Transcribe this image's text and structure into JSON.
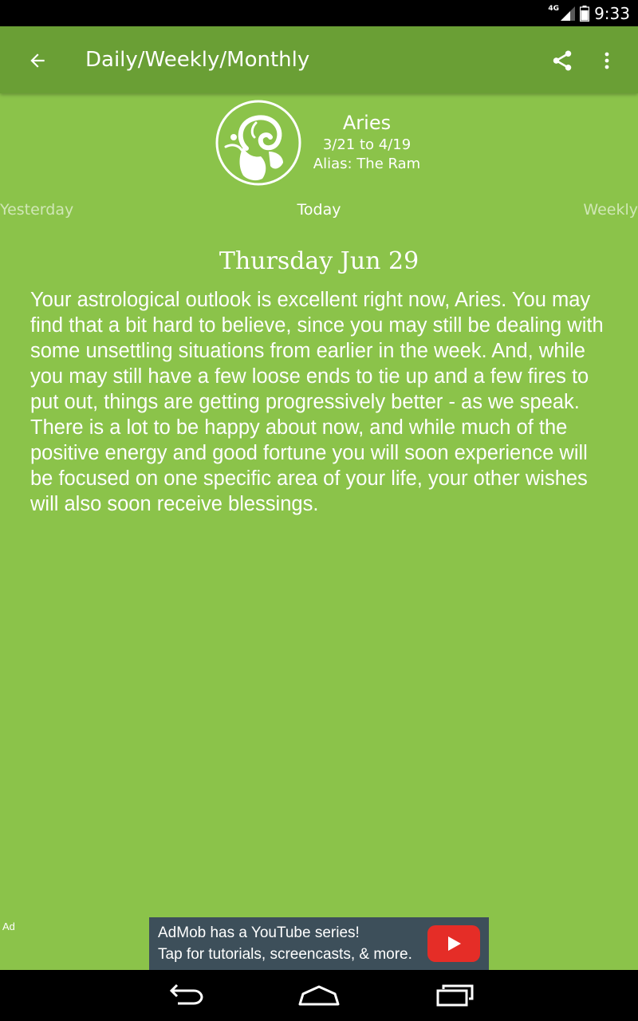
{
  "status_bar": {
    "network": "4G",
    "time": "9:33"
  },
  "toolbar": {
    "title": "Daily/Weekly/Monthly"
  },
  "sign": {
    "name": "Aries",
    "dates": "3/21 to 4/19",
    "alias": "Alias: The Ram"
  },
  "tabs": {
    "previous": "Yesterday",
    "current": "Today",
    "next": "Weekly"
  },
  "reading": {
    "date": "Thursday Jun 29",
    "text": "Your astrological outlook is excellent right now, Aries. You may find that a bit hard to believe, since you may still be dealing with some unsettling situations from earlier in the week. And, while you may still have a few loose ends to tie up and a few fires to put out, things are getting progressively better - as we speak. There is a lot to be happy about now, and while much of the positive energy and good fortune you will soon experience will be focused on one specific area of your life, your other wishes will also soon receive blessings."
  },
  "ad": {
    "label": "Ad",
    "line1": "AdMob has a YouTube series!",
    "line2": "Tap for tutorials, screencasts, & more."
  },
  "icons": {
    "back": "arrow-left",
    "share": "share",
    "more": "vertical-dots",
    "sign_logo": "ram",
    "ad_play": "youtube-play",
    "nav_back": "back",
    "nav_home": "home",
    "nav_recents": "recents"
  },
  "colors": {
    "background": "#8bc34a",
    "toolbar": "#6a9f35",
    "text": "#ffffff",
    "ad_background": "#3d4f5a",
    "youtube_red": "#e52d27"
  }
}
